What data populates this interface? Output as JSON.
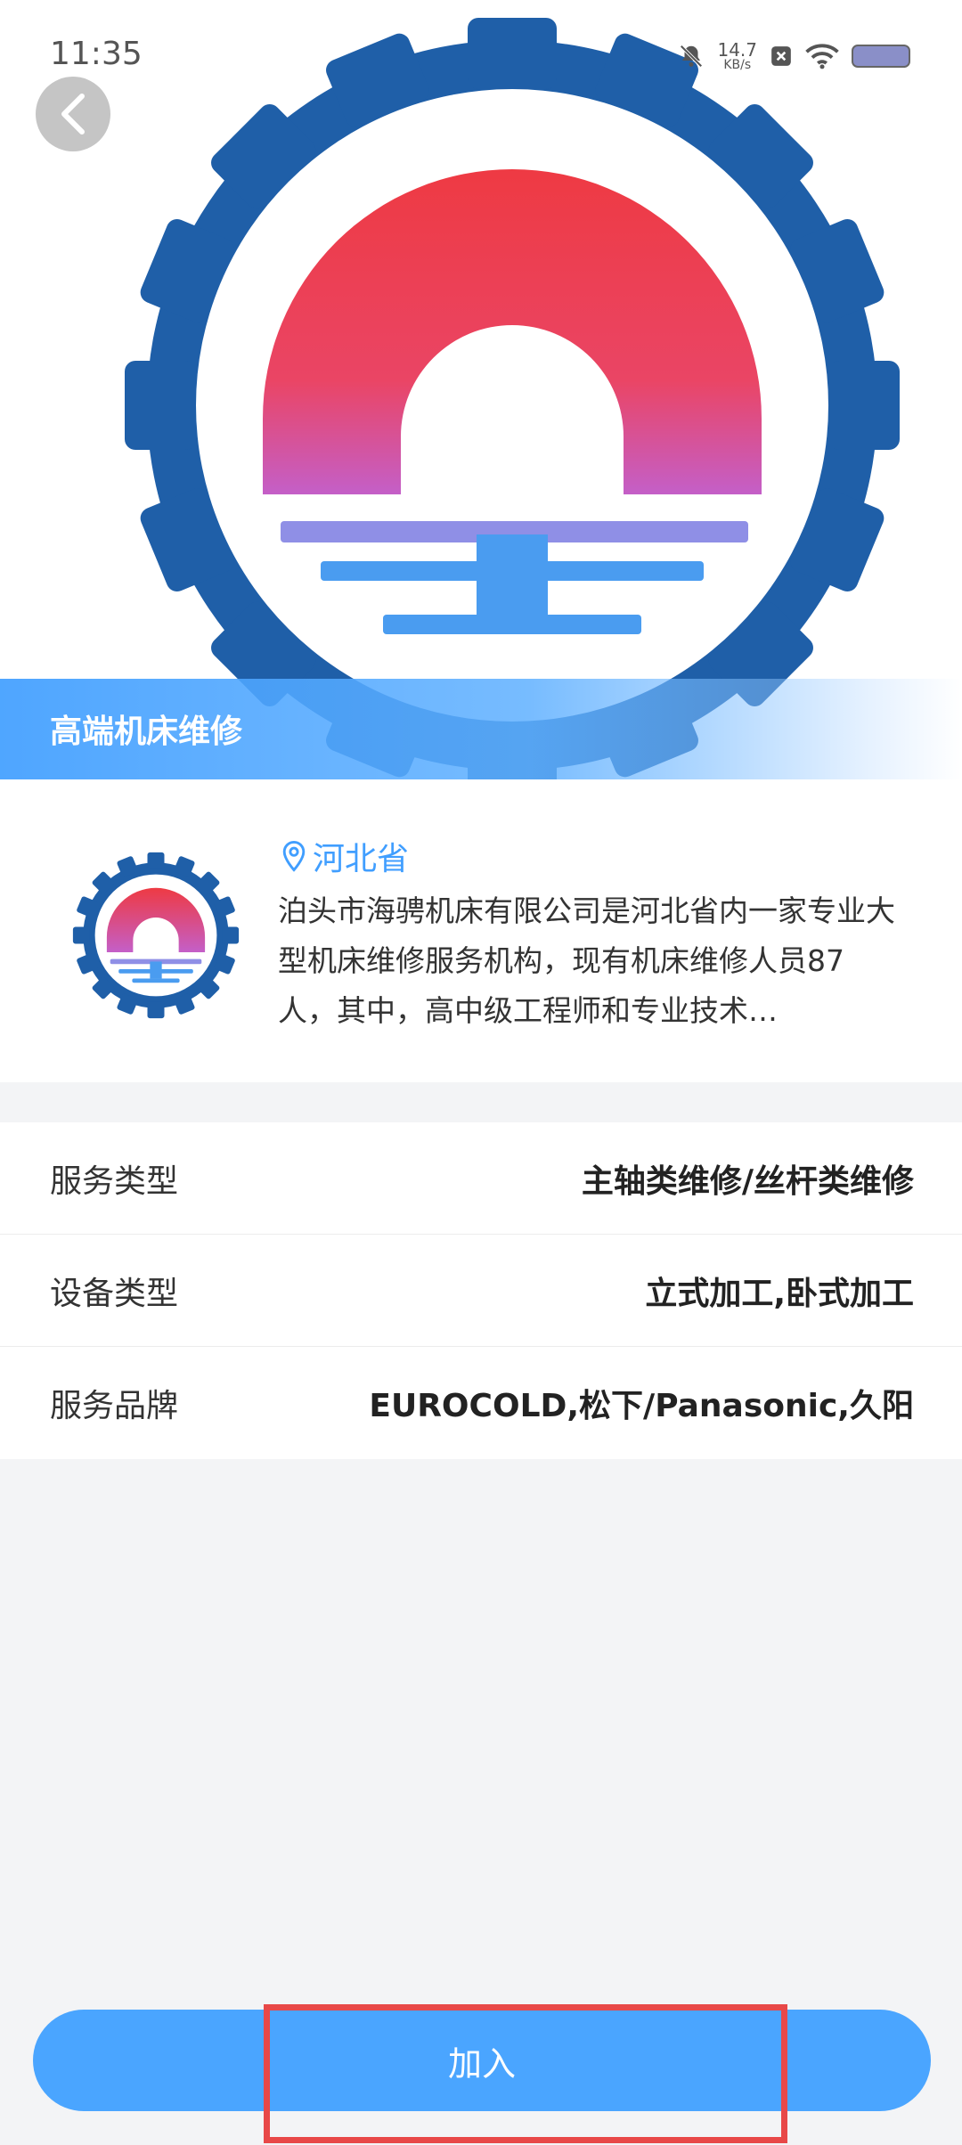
{
  "status_bar": {
    "time": "11:35",
    "net_speed_value": "14.7",
    "net_speed_unit": "KB/s",
    "icons": [
      "bell-off-icon",
      "close-badge-icon",
      "wifi-icon",
      "battery-icon"
    ]
  },
  "hero": {
    "banner_title": "高端机床维修",
    "back_icon": "chevron-left-icon"
  },
  "company": {
    "location": "河北省",
    "description": "泊头市海骋机床有限公司是河北省内一家专业大型机床维修服务机构，现有机床维修人员87人，其中，高中级工程师和专业技术…"
  },
  "details": [
    {
      "label": "服务类型",
      "value": "主轴类维修/丝杆类维修"
    },
    {
      "label": "设备类型",
      "value": "立式加工,卧式加工"
    },
    {
      "label": "服务品牌",
      "value": "EUROCOLD,松下/Panasonic,久阳"
    }
  ],
  "actions": {
    "join_label": "加入"
  },
  "colors": {
    "accent": "#409eff",
    "button": "#4aa5ff",
    "logo_red": "#e8434f",
    "logo_blue": "#1f5fa8",
    "highlight": "#e84848"
  }
}
